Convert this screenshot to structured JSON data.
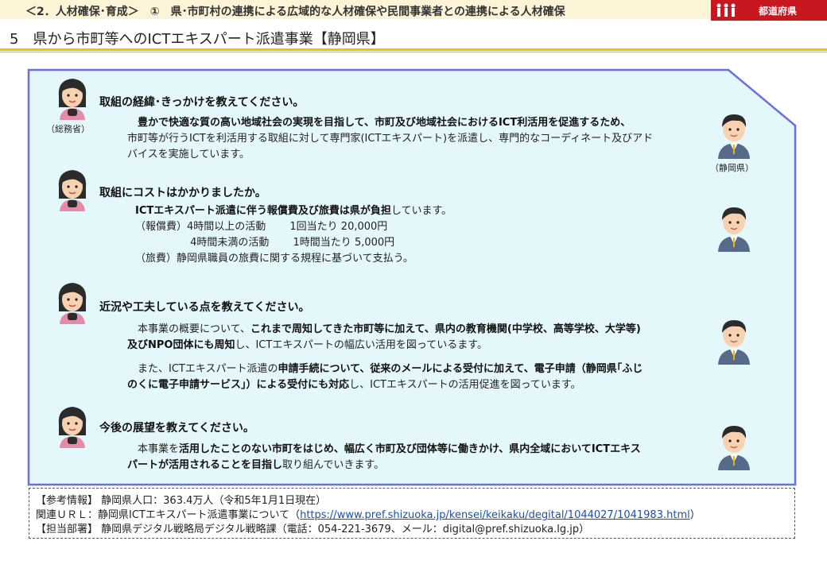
{
  "header": {
    "breadcrumb": "＜2．人材確保･育成＞　①　県･市町村の連携による広域的な人材確保や民間事業者との連携による人材確保",
    "badge_label": "都道府県"
  },
  "subtitle": "5　県から市町等へのICTエキスパート派遣事業【静岡県】",
  "speakers": {
    "ministry": "（総務省）",
    "prefecture": "（静岡県）"
  },
  "qa": [
    {
      "question": "取組の経緯･きっかけを教えてください。",
      "answer": [
        {
          "bold": "　豊かで快適な質の高い地域社会の実現を目指して、市町及び地域社会におけるICT利活用を促進するため、",
          "text": ""
        },
        {
          "bold": "",
          "text": "市町等が行うICTを利活用する取組に対して専門家(ICTエキスパート)を派遣し、専門的なコーディネート及びアド"
        },
        {
          "bold": "",
          "text": "バイスを実施しています。"
        }
      ]
    },
    {
      "question": "取組にコストはかかりましたか。",
      "answer": [
        {
          "bold": "ICTエキスパート派遣に伴う報償費及び旅費は県が負担",
          "text": "しています。"
        },
        {
          "bold": "",
          "text": "（報償費）4時間以上の活動　　 1回当たり 20,000円"
        },
        {
          "bold": "",
          "text": "　　　　　 4時間未満の活動　　 1時間当たり 5,000円"
        },
        {
          "bold": "",
          "text": "（旅費）静岡県職員の旅費に関する規程に基づいて支払う。"
        }
      ]
    },
    {
      "question": "近況や工夫している点を教えてください。",
      "answer": [
        {
          "text1": "　本事業の概要について、",
          "bold1": "これまで周知してきた市町等に加えて、県内の教育機関(中学校、高等学校、大学等)"
        },
        {
          "bold1": "及びNPO団体にも周知",
          "text1": "し、ICTエキスパートの幅広い活用を図っているます。"
        },
        {
          "text1": "　また、ICTエキスパート派遣の",
          "bold1": "申請手続について、従来のメールによる受付に加えて、電子申請（静岡県｢ふじ"
        },
        {
          "bold1": "のくに電子申請サービス｣）による受付にも対応",
          "text1": "し、ICTエキスパートの活用促進を図っています。"
        }
      ]
    },
    {
      "question": "今後の展望を教えてください。",
      "answer": [
        {
          "text1": "　本事業を",
          "bold1": "活用したことのない市町をはじめ、幅広く市町及び団体等に働きかけ、県内全域においてICTエキス"
        },
        {
          "bold1": "パートが活用されることを目指し",
          "text1": "取り組んでいきます。"
        }
      ]
    }
  ],
  "reference": {
    "info_label": "【参考情報】",
    "info_value": "静岡県人口：363.4万人（令和5年1月1日現在）",
    "url_label": "関連ＵＲＬ：",
    "url_text": "静岡県ICTエキスパート派遣事業について（",
    "url_link": "https://www.pref.shizuoka.jp/kensei/keikaku/degital/1044027/1041983.html",
    "url_close": "）",
    "dept_label": "【担当部署】",
    "dept_value": "静岡県デジタル戦略局デジタル戦略課（電話：054-221-3679、メール：digital@pref.shizuoka.lg.jp）"
  },
  "colors": {
    "panel_fill": "#e4f8fb",
    "panel_border": "#6c6fe2",
    "accent_gold": "#f2c200",
    "badge_red": "#c8171e"
  }
}
